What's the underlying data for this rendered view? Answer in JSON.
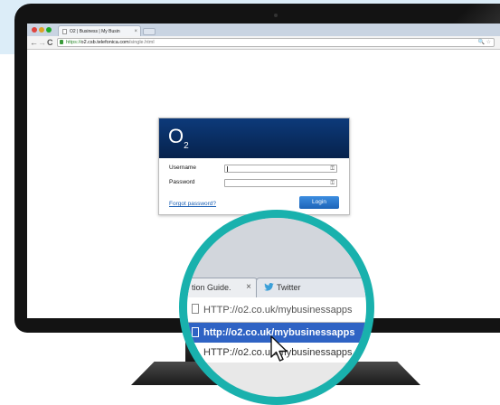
{
  "browser": {
    "tab_title": "O2 | Business | My Busin",
    "tab_close": "×",
    "url_scheme": "https://",
    "url_host": "o2.csb.telefonica.com",
    "url_path": "/single.html",
    "nav": {
      "back": "←",
      "forward": "→",
      "reload": "C"
    },
    "omnibox_icons": "🔍 ☆"
  },
  "login": {
    "logo": "O",
    "logo_sub": "2",
    "username_label": "Username",
    "password_label": "Password",
    "forgot_link": "Forgot password?",
    "login_button": "Login",
    "key_icon": "⚿"
  },
  "magnifier": {
    "tab1_label": "tion Guide.",
    "tab1_close": "×",
    "tab2_label": "Twitter",
    "address_text": "HTTP://o2.co.uk/mybusinessapps",
    "suggestion_highlight": "http://o2.co.uk/mybusinessapps",
    "suggestion": "HTTP://o2.co.uk/mybusinessapps -"
  },
  "colors": {
    "magnifier_ring": "#19b1ad",
    "o2_blue": "#0d3a7a",
    "login_button": "#1d64b8",
    "highlight": "#2f63c4"
  }
}
